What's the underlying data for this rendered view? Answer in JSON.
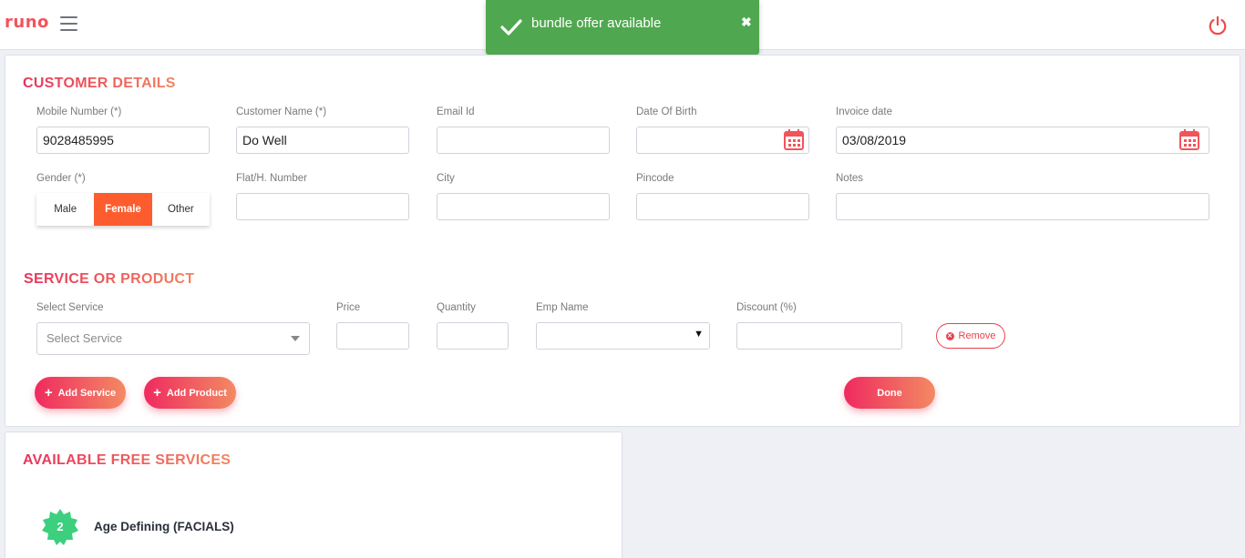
{
  "header": {
    "logo": "runo"
  },
  "toast": {
    "message": "bundle offer available",
    "close": "✖"
  },
  "customer_details": {
    "title": "CUSTOMER DETAILS",
    "fields": {
      "mobile": {
        "label": "Mobile Number (*)",
        "value": "9028485995"
      },
      "name": {
        "label": "Customer Name (*)",
        "value": "Do Well"
      },
      "email": {
        "label": "Email Id",
        "value": ""
      },
      "dob": {
        "label": "Date Of Birth",
        "value": ""
      },
      "invoice_date": {
        "label": "Invoice date",
        "value": "03/08/2019"
      },
      "gender": {
        "label": "Gender (*)",
        "options": [
          "Male",
          "Female",
          "Other"
        ],
        "selected": "Female"
      },
      "flat": {
        "label": "Flat/H. Number",
        "value": ""
      },
      "city": {
        "label": "City",
        "value": ""
      },
      "pincode": {
        "label": "Pincode",
        "value": ""
      },
      "notes": {
        "label": "Notes",
        "value": ""
      }
    }
  },
  "service": {
    "title": "SERVICE OR PRODUCT",
    "select_label": "Select Service",
    "select_placeholder": "Select Service",
    "price_label": "Price",
    "quantity_label": "Quantity",
    "emp_label": "Emp Name",
    "emp_arrow": "▼",
    "discount_label": "Discount (%)",
    "remove_label": "Remove",
    "add_service_label": "Add Service",
    "add_product_label": "Add Product",
    "done_label": "Done"
  },
  "free_services": {
    "title": "AVAILABLE FREE SERVICES",
    "items": [
      {
        "count": "2",
        "name": "Age Defining (FACIALS)"
      }
    ]
  },
  "colors": {
    "accent_start": "#ef2a5f",
    "accent_end": "#f38a63",
    "toast": "#4fa84f",
    "gender_active": "#fd5d2e",
    "badge": "#3ccf7e"
  }
}
